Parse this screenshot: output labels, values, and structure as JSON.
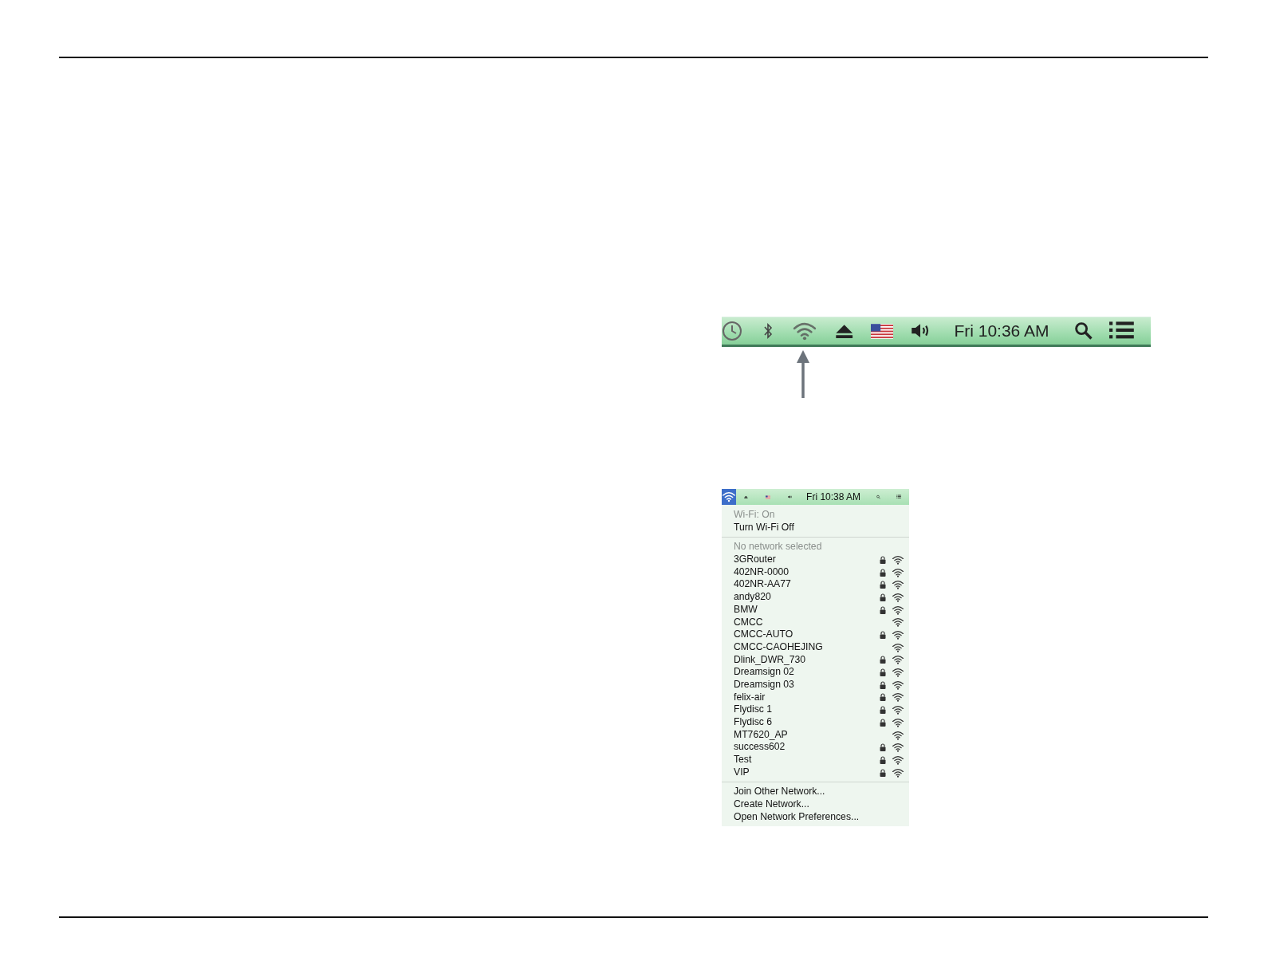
{
  "menu_bar": {
    "clock": "Fri 10:36 AM"
  },
  "wifi_menu": {
    "menu_bar": {
      "clock": "Fri 10:38 AM"
    },
    "status": "Wi-Fi: On",
    "toggle": "Turn Wi-Fi Off",
    "no_network": "No network selected",
    "networks": [
      {
        "name": "3GRouter",
        "locked": true
      },
      {
        "name": "402NR-0000",
        "locked": true
      },
      {
        "name": "402NR-AA77",
        "locked": true
      },
      {
        "name": "andy820",
        "locked": true
      },
      {
        "name": "BMW",
        "locked": true
      },
      {
        "name": "CMCC",
        "locked": false
      },
      {
        "name": "CMCC-AUTO",
        "locked": true
      },
      {
        "name": "CMCC-CAOHEJING",
        "locked": false
      },
      {
        "name": "Dlink_DWR_730",
        "locked": true
      },
      {
        "name": "Dreamsign 02",
        "locked": true
      },
      {
        "name": "Dreamsign 03",
        "locked": true
      },
      {
        "name": "felix-air",
        "locked": true
      },
      {
        "name": "Flydisc 1",
        "locked": true
      },
      {
        "name": "Flydisc 6",
        "locked": true
      },
      {
        "name": "MT7620_AP",
        "locked": false
      },
      {
        "name": "success602",
        "locked": true
      },
      {
        "name": "Test",
        "locked": true
      },
      {
        "name": "VIP",
        "locked": true
      }
    ],
    "actions": [
      "Join Other Network...",
      "Create Network...",
      "Open Network Preferences..."
    ]
  }
}
